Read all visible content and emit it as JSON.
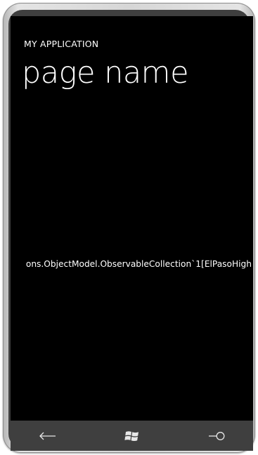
{
  "app": {
    "app_title": "MY APPLICATION",
    "page_title": "page name"
  },
  "content": {
    "text": "ons.ObjectModel.ObservableCollection`1[ElPasoHigh"
  },
  "hardware_buttons": {
    "back": "back-arrow-icon",
    "start": "windows-logo-icon",
    "search": "search-icon"
  },
  "colors": {
    "screen_background": "#000000",
    "text": "#ffffff",
    "bezel": "#3f3f3f",
    "frame": "#d6d6d6"
  }
}
